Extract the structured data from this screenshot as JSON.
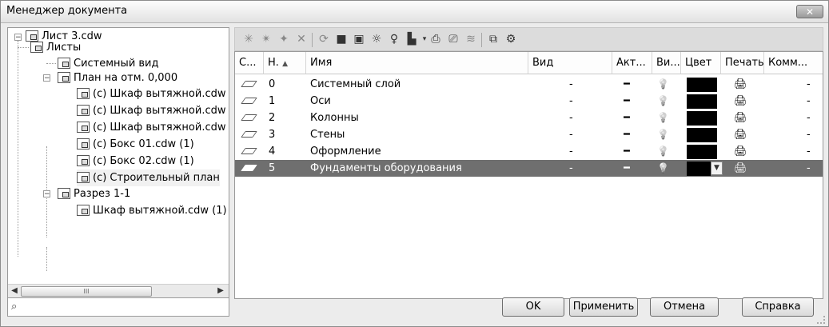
{
  "window": {
    "title": "Менеджер документа",
    "close_label": "✕"
  },
  "tree": {
    "items": [
      {
        "label": "Лист 3.cdw",
        "icon": "document-icon"
      },
      {
        "label": "Листы",
        "icon": "sheets-icon"
      },
      {
        "label": "Системный вид",
        "icon": "view-icon"
      },
      {
        "label": "План на отм. 0,000",
        "icon": "view-icon"
      },
      {
        "label": "(с) Шкаф вытяжной.cdw",
        "icon": "fragment-icon"
      },
      {
        "label": "(с) Шкаф вытяжной.cdw",
        "icon": "fragment-icon"
      },
      {
        "label": "(с) Шкаф вытяжной.cdw",
        "icon": "fragment-icon"
      },
      {
        "label": "(с) Бокс 01.cdw (1)",
        "icon": "fragment-icon"
      },
      {
        "label": "(с) Бокс 02.cdw (1)",
        "icon": "fragment-icon"
      },
      {
        "label": "(с) Строительный план",
        "icon": "fragment-icon"
      },
      {
        "label": "Разрез 1-1",
        "icon": "section-view-icon"
      },
      {
        "label": "Шкаф вытяжной.cdw (1)",
        "icon": "fragment-icon"
      }
    ],
    "scrollbar_thumb": "III"
  },
  "toolbar": {
    "icons": [
      "new-layer-icon",
      "new-layer-group-icon",
      "clear-layer-icon",
      "delete-icon",
      "refresh-icon",
      "lock-icon",
      "unlock-icon",
      "bulb-on-icon",
      "bulb-off-icon",
      "color-icon",
      "print-icon",
      "print-off-icon",
      "layer-props-icon",
      "copy-layer-icon",
      "filter-icon"
    ]
  },
  "grid": {
    "columns": [
      "С...",
      "Н.",
      "Имя",
      "Вид",
      "Акт...",
      "Ви...",
      "Цвет",
      "Печать",
      "Комм..."
    ],
    "rows": [
      {
        "num": "0",
        "name": "Системный слой",
        "vid": "-",
        "active": "━",
        "visible": "💡",
        "color": "#000000",
        "print": "🖨",
        "comment": "-",
        "selected": false
      },
      {
        "num": "1",
        "name": "Оси",
        "vid": "-",
        "active": "━",
        "visible": "💡",
        "color": "#000000",
        "print": "🖨",
        "comment": "-",
        "selected": false
      },
      {
        "num": "2",
        "name": "Колонны",
        "vid": "-",
        "active": "━",
        "visible": "💡",
        "color": "#000000",
        "print": "🖨",
        "comment": "-",
        "selected": false
      },
      {
        "num": "3",
        "name": "Стены",
        "vid": "-",
        "active": "━",
        "visible": "💡",
        "color": "#000000",
        "print": "🖨",
        "comment": "-",
        "selected": false
      },
      {
        "num": "4",
        "name": "Оформление",
        "vid": "-",
        "active": "━",
        "visible": "💡",
        "color": "#000000",
        "print": "🖨",
        "comment": "-",
        "selected": false
      },
      {
        "num": "5",
        "name": "Фундаменты оборудования",
        "vid": "-",
        "active": "━",
        "visible": "💡",
        "color": "#000000",
        "print": "🖨",
        "comment": "-",
        "selected": true
      }
    ]
  },
  "buttons": {
    "ok": "OK",
    "apply": "Применить",
    "cancel": "Отмена",
    "help": "Справка"
  }
}
